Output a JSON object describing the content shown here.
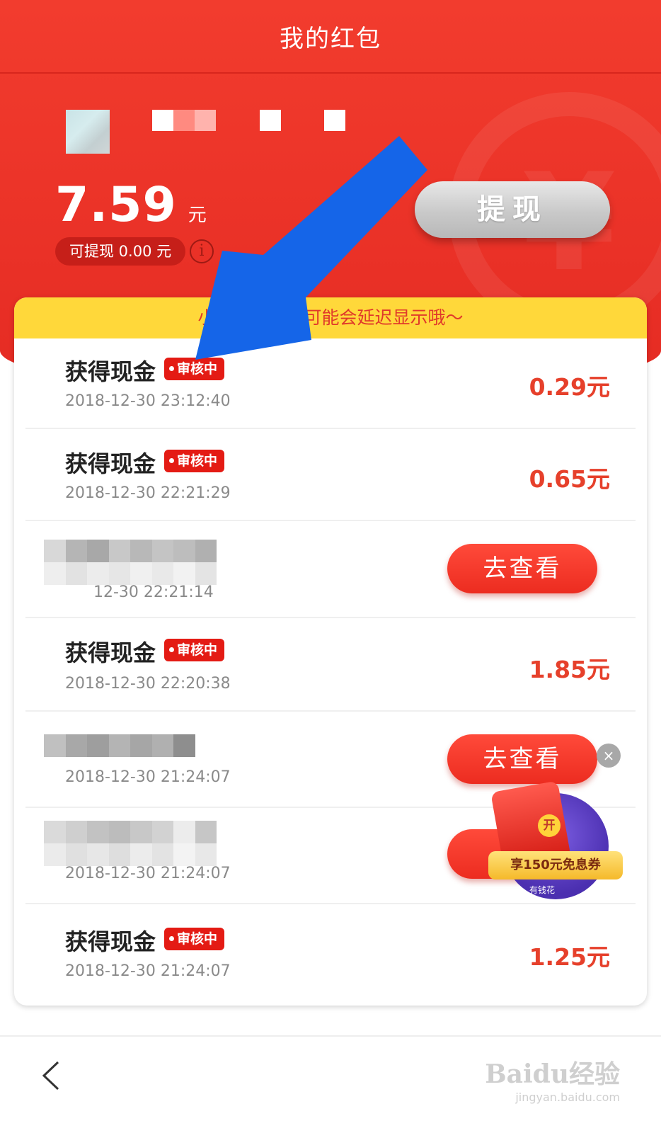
{
  "header": {
    "title": "我的红包",
    "balance": "7.59",
    "balance_unit": "元",
    "withdrawable_text": "可提现 0.00 元",
    "info_symbol": "i",
    "withdraw_label": "提现",
    "watermark_glyph": "¥"
  },
  "tip": {
    "text": "小提示：奖品可能会延迟显示哦～"
  },
  "records": [
    {
      "label": "获得现金",
      "badge": "审核中",
      "time": "2018-12-30 23:12:40",
      "amount": "0.29元"
    },
    {
      "label": "获得现金",
      "badge": "审核中",
      "time": "2018-12-30 22:21:29",
      "amount": "0.65元"
    },
    {
      "time": "12-30 22:21:14",
      "action": "去查看"
    },
    {
      "label": "获得现金",
      "badge": "审核中",
      "time": "2018-12-30 22:20:38",
      "amount": "1.85元"
    },
    {
      "time": "2018-12-30 21:24:07",
      "action": "去查看"
    },
    {
      "time": "2018-12-30 21:24:07"
    },
    {
      "label": "获得现金",
      "badge": "审核中",
      "time": "2018-12-30 21:24:07",
      "amount": "1.25元"
    }
  ],
  "ad": {
    "coin": "开",
    "banner": "享150元免息券",
    "brand": "有钱花",
    "close": "×"
  },
  "footer": {
    "watermark_main": "Baidu经验",
    "watermark_sub": "jingyan.baidu.com"
  },
  "colors": {
    "brand_red": "#e52b23",
    "amount_red": "#e6402b",
    "badge_red": "#e41b14",
    "tip_yellow": "#ffd83a",
    "annotation_arrow": "#1565e8"
  }
}
